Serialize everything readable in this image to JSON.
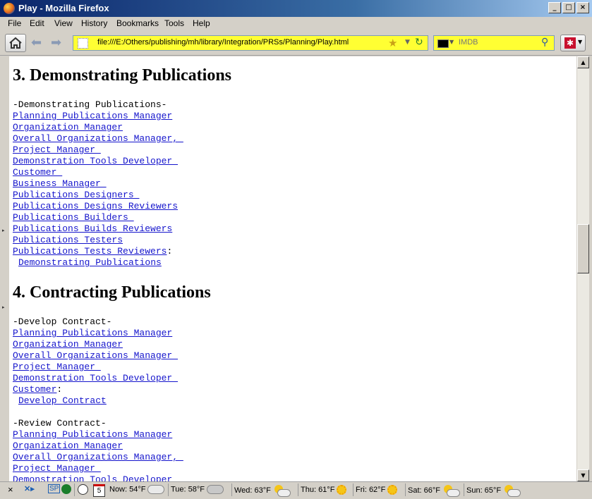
{
  "window": {
    "title": "Play - Mozilla Firefox"
  },
  "menu": [
    "File",
    "Edit",
    "View",
    "History",
    "Bookmarks",
    "Tools",
    "Help"
  ],
  "nav": {
    "url": "file:///E:/Others/publishing/mh/library/Integration/PRSs/Planning/Play.html",
    "search_placeholder": "IMDB"
  },
  "content": {
    "section3": {
      "heading": "3. Demonstrating Publications",
      "label": "-Demonstrating Publications-",
      "links": [
        "Planning Publications Manager",
        "Organization Manager",
        "Overall Organizations Manager, ",
        "Project Manager ",
        "Demonstration Tools Developer ",
        "Customer ",
        "Business Manager ",
        "Publications Designers ",
        "Publications Designs Reviewers",
        "Publications Builders ",
        "Publications Builds Reviewers",
        "Publications Testers",
        "Publications Tests Reviewers"
      ],
      "colon": ":",
      "target": "Demonstrating Publications"
    },
    "section4": {
      "heading": "4. Contracting Publications",
      "block1": {
        "label": "-Develop Contract-",
        "links": [
          "Planning Publications Manager",
          "Organization Manager",
          "Overall Organizations Manager ",
          "Project Manager ",
          "Demonstration Tools Developer ",
          "Customer"
        ],
        "colon": ":",
        "target": "Develop Contract"
      },
      "block2": {
        "label": "-Review Contract-",
        "links": [
          "Planning Publications Manager",
          "Organization Manager",
          "Overall Organizations Manager, ",
          "Project Manager ",
          "Demonstration Tools Developer"
        ]
      }
    }
  },
  "status": {
    "weather": [
      {
        "label": "Now: 54°F",
        "icon": "cloud-icon"
      },
      {
        "label": "Tue: 58°F",
        "icon": "rain-cloud-icon"
      },
      {
        "label": "Wed: 63°F",
        "icon": "partly-sunny-icon"
      },
      {
        "label": "Thu: 61°F",
        "icon": "sun-icon"
      },
      {
        "label": "Fri: 62°F",
        "icon": "sun-icon"
      },
      {
        "label": "Sat: 66°F",
        "icon": "partly-sunny-icon"
      },
      {
        "label": "Sun: 65°F",
        "icon": "partly-sunny-icon"
      }
    ],
    "calendar_day": "5"
  },
  "colors": {
    "link": "#1515cc",
    "url_background": "#ffff33",
    "title_gradient_start": "#0a246a"
  }
}
